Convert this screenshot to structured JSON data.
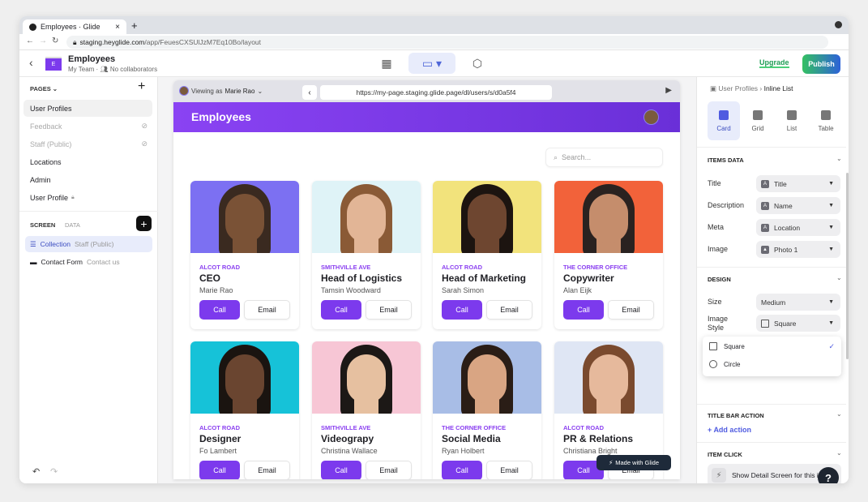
{
  "browser": {
    "tab_title": "Employees · Glide",
    "url_host": "staging.heyglide.com",
    "url_path": "/app/FeuesCXSUlJzM7Eq10Bo/layout"
  },
  "header": {
    "app_icon_letter": "E",
    "title": "Employees",
    "team": "My Team",
    "collaborators": "No collaborators",
    "upgrade_label": "Upgrade",
    "publish_label": "Publish"
  },
  "sidebar": {
    "pages_label": "PAGES",
    "pages": [
      {
        "label": "User Profiles",
        "selected": true
      },
      {
        "label": "Feedback",
        "hidden": true
      },
      {
        "label": "Staff (Public)",
        "hidden": true
      },
      {
        "label": "Locations"
      },
      {
        "label": "Admin"
      },
      {
        "label": "User Profile",
        "locked": true
      }
    ],
    "screen_tab": "SCREEN",
    "data_tab": "DATA",
    "screens": [
      {
        "label": "Collection",
        "sub": "Staff (Public)",
        "icon": "list-icon",
        "selected": true
      },
      {
        "label": "Contact Form",
        "sub": "Contact us",
        "icon": "form-icon"
      }
    ]
  },
  "preview": {
    "viewing_as_prefix": "Viewing as",
    "viewing_as_name": "Marie Rao",
    "url": "https://my-page.staging.glide.page/dl/users/s/d0a5f4",
    "page_title": "Employees",
    "search_placeholder": "Search...",
    "made_with": "Made with Glide",
    "accent": "#7c3aed",
    "cards": [
      {
        "location": "ALCOT ROAD",
        "title": "CEO",
        "name": "Marie Rao",
        "bg": "#7c70f2",
        "skin": "#7a5236",
        "hair": "#3a2a20",
        "call": "Call",
        "email": "Email"
      },
      {
        "location": "SMITHVILLE AVE",
        "title": "Head of Logistics",
        "name": "Tamsin Woodward",
        "bg": "#dff3f7",
        "skin": "#e2b596",
        "hair": "#8a5a36",
        "call": "Call",
        "email": "Email"
      },
      {
        "location": "ALCOT ROAD",
        "title": "Head of Marketing",
        "name": "Sarah Simon",
        "bg": "#f2e37c",
        "skin": "#6e4630",
        "hair": "#1c1410",
        "call": "Call",
        "email": "Email"
      },
      {
        "location": "THE CORNER OFFICE",
        "title": "Copywriter",
        "name": "Alan Eijk",
        "bg": "#f2623a",
        "skin": "#c58d6c",
        "hair": "#2a2220",
        "call": "Call",
        "email": "Email"
      },
      {
        "location": "ALCOT ROAD",
        "title": "Designer",
        "name": "Fo Lambert",
        "bg": "#16c2d8",
        "skin": "#6a4530",
        "hair": "#1a1410",
        "call": "Call",
        "email": "Email"
      },
      {
        "location": "SMITHVILLE AVE",
        "title": "Videograpy",
        "name": "Christina Wallace",
        "bg": "#f7c6d5",
        "skin": "#e6c0a0",
        "hair": "#1c1816",
        "call": "Call",
        "email": "Email"
      },
      {
        "location": "THE CORNER OFFICE",
        "title": "Social Media",
        "name": "Ryan Holbert",
        "bg": "#a8bde6",
        "skin": "#d9a583",
        "hair": "#2a1d16",
        "call": "Call",
        "email": "Email"
      },
      {
        "location": "ALCOT ROAD",
        "title": "PR & Relations",
        "name": "Christiana Bright",
        "bg": "#dfe6f4",
        "skin": "#e6b99c",
        "hair": "#7a4a2e",
        "call": "Call",
        "email": "Email"
      }
    ]
  },
  "inspector": {
    "breadcrumb_parent": "User Profiles",
    "breadcrumb_current": "Inline List",
    "styles": [
      {
        "label": "Card",
        "active": true
      },
      {
        "label": "Grid"
      },
      {
        "label": "List"
      },
      {
        "label": "Table"
      }
    ],
    "items_data_label": "ITEMS DATA",
    "fields": [
      {
        "label": "Title",
        "value": "Title",
        "icon": "A"
      },
      {
        "label": "Description",
        "value": "Name",
        "icon": "A"
      },
      {
        "label": "Meta",
        "value": "Location",
        "icon": "A"
      },
      {
        "label": "Image",
        "value": "Photo 1",
        "icon": "image"
      }
    ],
    "design_label": "DESIGN",
    "size_label": "Size",
    "size_value": "Medium",
    "image_style_label_1": "Image",
    "image_style_label_2": "Style",
    "image_style_value": "Square",
    "image_style_options": [
      {
        "label": "Square",
        "selected": true
      },
      {
        "label": "Circle"
      }
    ],
    "title_bar_action_label": "TITLE BAR ACTION",
    "add_action_label": "Add action",
    "item_click_label": "ITEM CLICK",
    "item_click_value": "Show Detail Screen for this item",
    "help_label": "?"
  }
}
